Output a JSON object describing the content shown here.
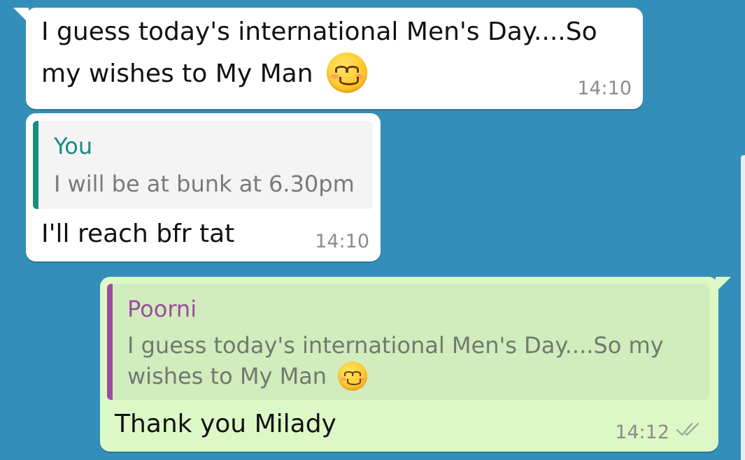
{
  "conversation": {
    "messages": [
      {
        "direction": "incoming",
        "text_line1": "I guess today's international Men's Day....So",
        "text_line2": "my wishes to My Man",
        "emoji": "smiling-face-with-blush-icon",
        "time": "14:10"
      },
      {
        "direction": "incoming",
        "reply": {
          "author": "You",
          "text": "I will be at bunk at 6.30pm"
        },
        "text": "I'll reach bfr tat",
        "time": "14:10"
      },
      {
        "direction": "outgoing",
        "reply": {
          "author": "Poorni",
          "text_line1": "I guess today's international Men's Day....So my",
          "text_line2": "wishes to My Man",
          "emoji": "smiling-face-with-blush-icon"
        },
        "text": "Thank you Milady",
        "time": "14:12",
        "status_icon": "double-check-icon",
        "status": "delivered"
      }
    ]
  },
  "colors": {
    "background": "#338fba",
    "incoming_bubble": "#ffffff",
    "outgoing_bubble": "#dcf8c6",
    "reply_author_you": "#1a8c80",
    "reply_author_poorni": "#9b4d9b",
    "reply_bar_you": "#1a8c80",
    "reply_bar_poorni": "#9b4d9b",
    "timestamp": "#8c8c8c",
    "message_text": "#111111"
  }
}
